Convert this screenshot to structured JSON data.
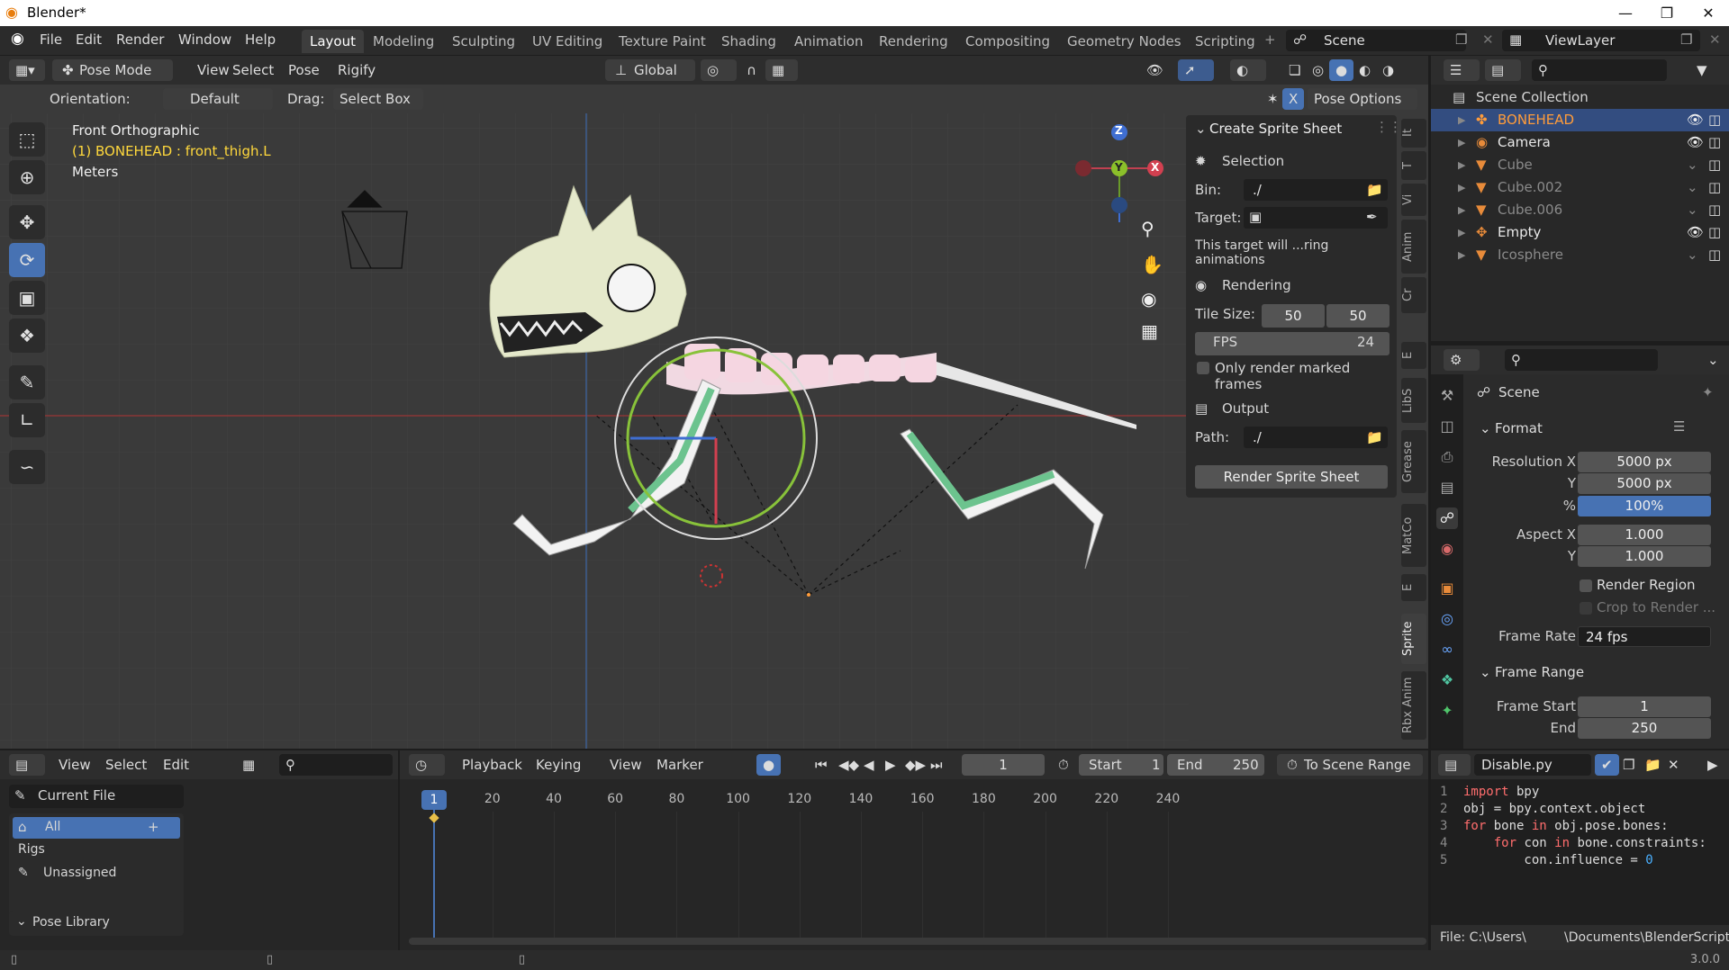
{
  "window": {
    "title": "Blender*",
    "version": "3.0.0"
  },
  "menu": [
    "File",
    "Edit",
    "Render",
    "Window",
    "Help"
  ],
  "workspaces": [
    "Layout",
    "Modeling",
    "Sculpting",
    "UV Editing",
    "Texture Paint",
    "Shading",
    "Animation",
    "Rendering",
    "Compositing",
    "Geometry Nodes",
    "Scripting"
  ],
  "scene": {
    "name": "Scene",
    "view_layer": "ViewLayer"
  },
  "viewport_header": {
    "mode": "Pose Mode",
    "menus": [
      "View",
      "Select",
      "Pose",
      "Rigify"
    ],
    "transform_orientation": "Global",
    "orientation_label": "Orientation:",
    "orientation_value": "Default",
    "drag_label": "Drag:",
    "drag_value": "Select Box",
    "pose_options": "Pose Options"
  },
  "viewport_overlay": {
    "view_name": "Front Orthographic",
    "active": "(1) BONEHEAD : front_thigh.L",
    "units": "Meters"
  },
  "gizmo": {
    "z": "Z",
    "y": "Y",
    "x": "X"
  },
  "sprite_panel": {
    "title": "Create Sprite Sheet",
    "selection": "Selection",
    "bin_label": "Bin:",
    "bin_value": "./",
    "target_label": "Target:",
    "info": "This target will ...ring animations",
    "rendering": "Rendering",
    "tile_size_label": "Tile Size:",
    "tile_w": "50",
    "tile_h": "50",
    "fps_label": "FPS",
    "fps_value": "24",
    "only_marked": "Only render marked frames",
    "output": "Output",
    "path_label": "Path:",
    "path_value": "./",
    "render_button": "Render Sprite Sheet"
  },
  "sidebar_tabs": [
    "It",
    "T",
    "Vi",
    "Anim",
    "Cr",
    "E",
    "LibS",
    "Grease",
    "MatCo",
    "E",
    "Sprite",
    "Rbx Anim"
  ],
  "outliner": {
    "root": "Scene Collection",
    "items": [
      {
        "name": "BONEHEAD",
        "selected": true,
        "color": "#ff9c3a"
      },
      {
        "name": "Camera",
        "selected": false,
        "color": "#e8e8e8"
      },
      {
        "name": "Cube",
        "selected": false,
        "color": "#8a8a8a"
      },
      {
        "name": "Cube.002",
        "selected": false,
        "color": "#8a8a8a"
      },
      {
        "name": "Cube.006",
        "selected": false,
        "color": "#8a8a8a"
      },
      {
        "name": "Empty",
        "selected": false,
        "color": "#e8e8e8"
      },
      {
        "name": "Icosphere",
        "selected": false,
        "color": "#8a8a8a"
      }
    ]
  },
  "properties": {
    "context": "Scene",
    "format_section": "Format",
    "res_x_label": "Resolution X",
    "res_x": "5000 px",
    "res_y_label": "Y",
    "res_y": "5000 px",
    "percent_label": "%",
    "percent": "100%",
    "aspect_x_label": "Aspect X",
    "aspect_x": "1.000",
    "aspect_y_label": "Y",
    "aspect_y": "1.000",
    "render_region": "Render Region",
    "crop_to_render": "Crop to Render ...",
    "frame_rate_label": "Frame Rate",
    "frame_rate": "24 fps",
    "frame_range_section": "Frame Range",
    "frame_start_label": "Frame Start",
    "frame_start": "1",
    "end_label": "End",
    "end": "250"
  },
  "asset_browser": {
    "menus": [
      "View",
      "Select",
      "Edit"
    ],
    "library": "Current File",
    "categories": [
      "All",
      "Rigs",
      "Unassigned"
    ],
    "pose_library": "Pose Library"
  },
  "timeline": {
    "menus": [
      "Playback",
      "Keying",
      "View",
      "Marker"
    ],
    "current_frame": "1",
    "start_label": "Start",
    "start": "1",
    "end_label": "End",
    "end": "250",
    "scene_range": "To Scene Range",
    "ticks": [
      "20",
      "40",
      "60",
      "80",
      "100",
      "120",
      "140",
      "160",
      "180",
      "200",
      "220",
      "240"
    ],
    "playhead": "1"
  },
  "text_editor": {
    "filename": "Disable.py",
    "lines": [
      {
        "n": "1",
        "text": "import bpy"
      },
      {
        "n": "2",
        "text": "obj = bpy.context.object"
      },
      {
        "n": "3",
        "text": "for bone in obj.pose.bones:"
      },
      {
        "n": "4",
        "text": "    for con in bone.constraints:"
      },
      {
        "n": "5",
        "text": "        con.influence = 0"
      }
    ],
    "footer_left": "File: C:\\Users\\",
    "footer_right": "\\Documents\\BlenderScript"
  }
}
